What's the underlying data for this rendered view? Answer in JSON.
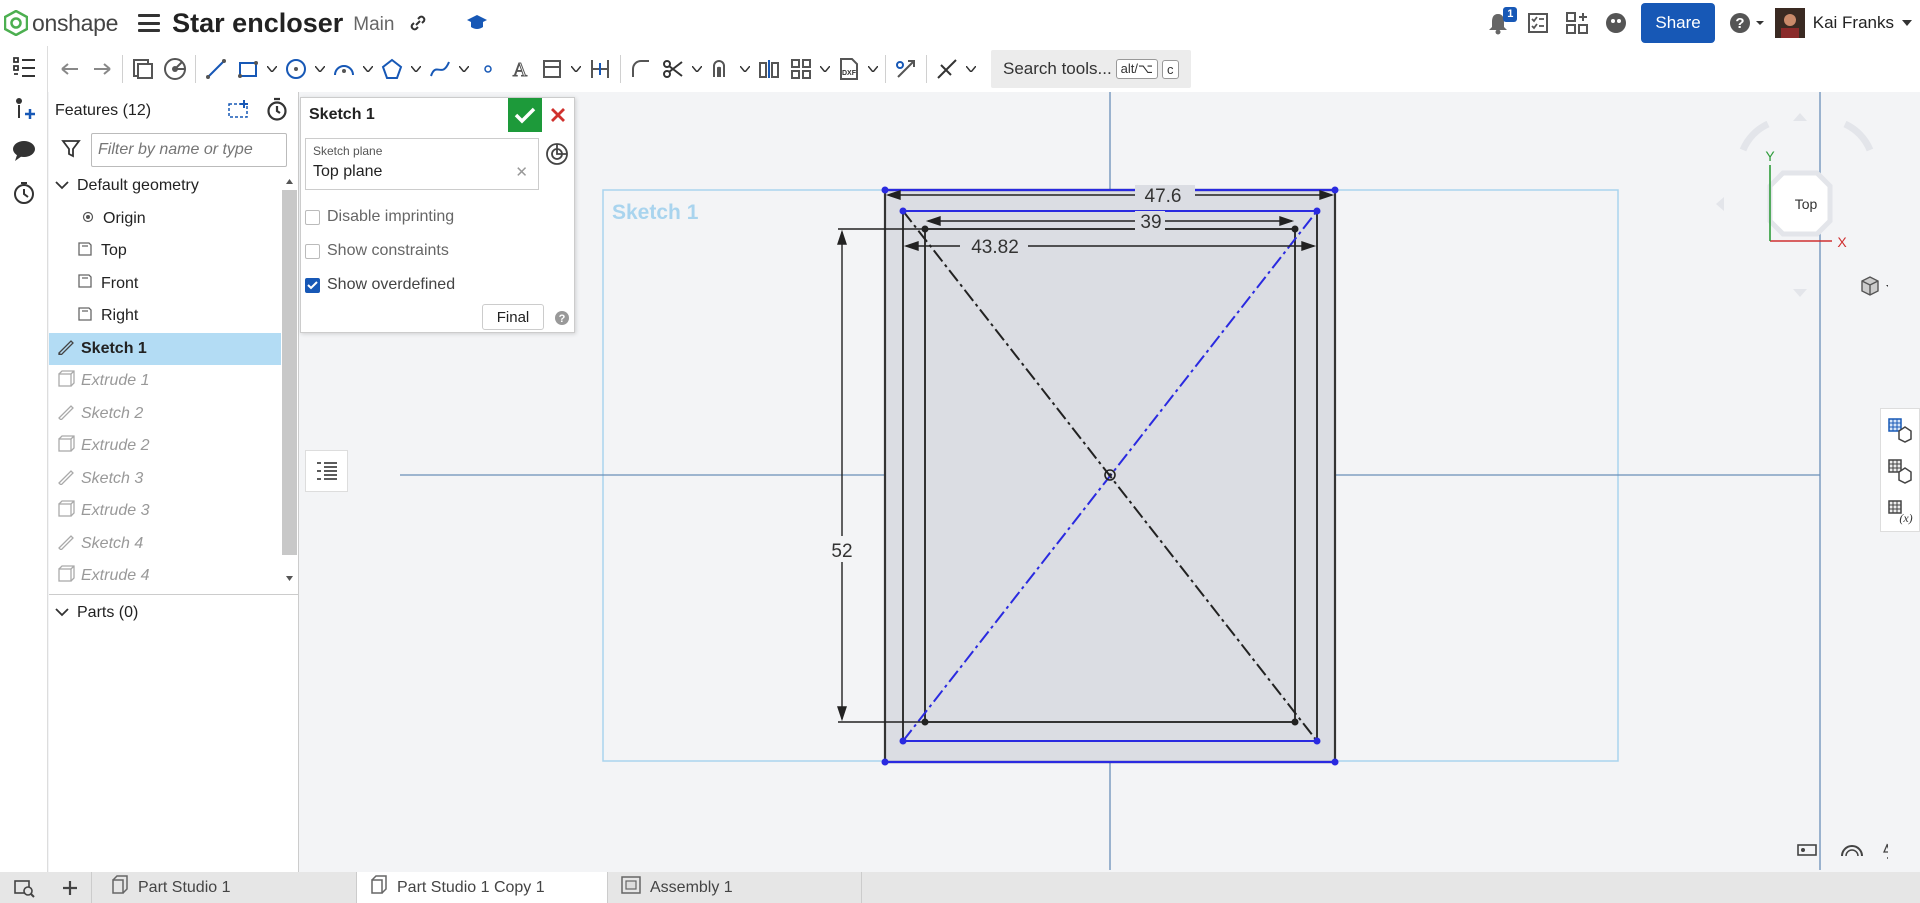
{
  "app": {
    "logo_text": "onshape",
    "doc_title": "Star encloser",
    "branch": "Main"
  },
  "topright": {
    "notification_count": "1",
    "share_label": "Share",
    "user_name": "Kai Franks"
  },
  "toolbar": {
    "search_label": "Search tools...",
    "shortcut_key1": "alt/⌥",
    "shortcut_key2": "c"
  },
  "features": {
    "title": "Features (12)",
    "filter_placeholder": "Filter by name or type",
    "default_geometry": "Default geometry",
    "items": [
      {
        "label": "Origin",
        "icon": "origin-icon"
      },
      {
        "label": "Top",
        "icon": "plane-icon"
      },
      {
        "label": "Front",
        "icon": "plane-icon"
      },
      {
        "label": "Right",
        "icon": "plane-icon"
      },
      {
        "label": "Sketch 1",
        "icon": "sketch-icon"
      },
      {
        "label": "Extrude 1",
        "icon": "extrude-icon"
      },
      {
        "label": "Sketch 2",
        "icon": "sketch-icon"
      },
      {
        "label": "Extrude 2",
        "icon": "extrude-icon"
      },
      {
        "label": "Sketch 3",
        "icon": "sketch-icon"
      },
      {
        "label": "Extrude 3",
        "icon": "extrude-icon"
      },
      {
        "label": "Sketch 4",
        "icon": "sketch-icon"
      },
      {
        "label": "Extrude 4",
        "icon": "extrude-icon"
      }
    ],
    "parts_label": "Parts (0)"
  },
  "sketch_dialog": {
    "title": "Sketch 1",
    "plane_label": "Sketch plane",
    "plane_value": "Top plane",
    "disable_imprinting": "Disable imprinting",
    "show_constraints": "Show constraints",
    "show_overdefined": "Show overdefined",
    "show_overdefined_checked": true,
    "final_label": "Final"
  },
  "viewport": {
    "sketch_label": "Sketch 1",
    "dim_width_outer": "47.6",
    "dim_width_inner": "39",
    "dim_width_mid": "43.82",
    "dim_height": "52",
    "view_cube_label": "Top",
    "axis_y": "Y",
    "axis_x": "X"
  },
  "tabs": [
    {
      "label": "Part Studio 1",
      "active": false
    },
    {
      "label": "Part Studio 1 Copy 1",
      "active": true
    },
    {
      "label": "Assembly 1",
      "active": false
    }
  ],
  "colors": {
    "accent": "#1758b6",
    "ok_green": "#1d9a3a",
    "cancel_red": "#d0312d",
    "sketch_blue": "#2a2ae0",
    "selected_row": "#b3dcf4"
  }
}
